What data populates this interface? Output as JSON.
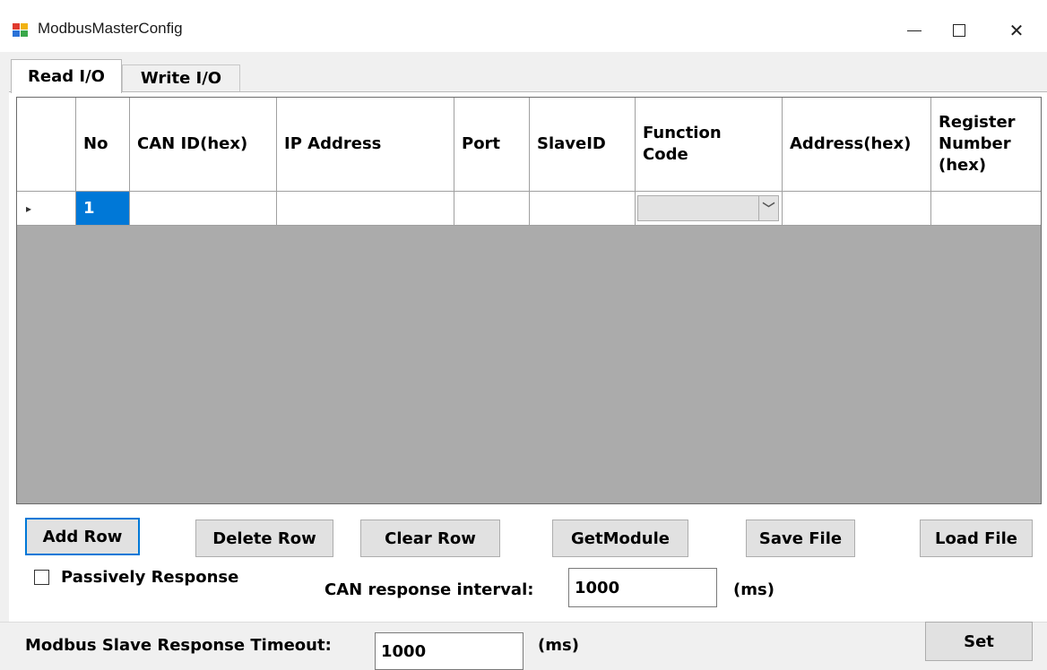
{
  "window": {
    "title": "ModbusMasterConfig",
    "icon": "app-window-icon",
    "controls": {
      "minimize": "—",
      "close": "✕"
    }
  },
  "tabs": [
    {
      "label": "Read I/O",
      "active": true
    },
    {
      "label": "Write I/O",
      "active": false
    }
  ],
  "grid": {
    "columns": [
      "",
      "No",
      "CAN ID(hex)",
      "IP Address",
      "Port",
      "SlaveID",
      "Function Code",
      "Address(hex)",
      "Register Number (hex)"
    ],
    "rows": [
      {
        "indicator": "▸",
        "no": "1",
        "can_id": "",
        "ip": "",
        "port": "",
        "slave_id": "",
        "function_code": "",
        "address": "",
        "register_number": ""
      }
    ],
    "combo_arrow": "﹀"
  },
  "buttons": {
    "add_row": "Add Row",
    "delete_row": "Delete Row",
    "clear_row": "Clear Row",
    "get_module": "GetModule",
    "save_file": "Save File",
    "load_file": "Load File",
    "set": "Set"
  },
  "options": {
    "passively_response": "Passively Response",
    "passively_response_checked": false,
    "can_interval_label": "CAN response interval:",
    "can_interval_value": "1000",
    "can_interval_unit": "(ms)"
  },
  "timeout": {
    "label": "Modbus Slave Response Timeout:",
    "value": "1000",
    "unit": "(ms)"
  },
  "colors": {
    "selection": "#0078d7",
    "grid_background": "#ababab",
    "button_face": "#e1e1e1"
  }
}
